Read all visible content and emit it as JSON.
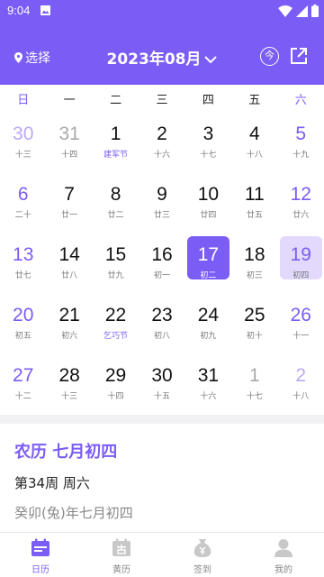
{
  "status_bar": {
    "time": "9:04"
  },
  "header": {
    "location_label": "选择",
    "month_title": "2023年08月",
    "today_button": "今"
  },
  "weekdays": [
    "日",
    "一",
    "二",
    "三",
    "四",
    "五",
    "六"
  ],
  "calendar": [
    [
      {
        "day": "30",
        "lunar": "十三",
        "other": true
      },
      {
        "day": "31",
        "lunar": "十四",
        "other": true
      },
      {
        "day": "1",
        "lunar": "建军节",
        "festival": true
      },
      {
        "day": "2",
        "lunar": "十六"
      },
      {
        "day": "3",
        "lunar": "十七"
      },
      {
        "day": "4",
        "lunar": "十八"
      },
      {
        "day": "5",
        "lunar": "十九"
      }
    ],
    [
      {
        "day": "6",
        "lunar": "二十"
      },
      {
        "day": "7",
        "lunar": "廿一"
      },
      {
        "day": "8",
        "lunar": "廿二"
      },
      {
        "day": "9",
        "lunar": "廿三"
      },
      {
        "day": "10",
        "lunar": "廿四"
      },
      {
        "day": "11",
        "lunar": "廿五"
      },
      {
        "day": "12",
        "lunar": "廿六"
      }
    ],
    [
      {
        "day": "13",
        "lunar": "廿七"
      },
      {
        "day": "14",
        "lunar": "廿八"
      },
      {
        "day": "15",
        "lunar": "廿九"
      },
      {
        "day": "16",
        "lunar": "初一"
      },
      {
        "day": "17",
        "lunar": "初二",
        "selected": true
      },
      {
        "day": "18",
        "lunar": "初三"
      },
      {
        "day": "19",
        "lunar": "初四",
        "today": true
      }
    ],
    [
      {
        "day": "20",
        "lunar": "初五"
      },
      {
        "day": "21",
        "lunar": "初六"
      },
      {
        "day": "22",
        "lunar": "乞巧节",
        "festival": true
      },
      {
        "day": "23",
        "lunar": "初八"
      },
      {
        "day": "24",
        "lunar": "初九"
      },
      {
        "day": "25",
        "lunar": "初十"
      },
      {
        "day": "26",
        "lunar": "十一"
      }
    ],
    [
      {
        "day": "27",
        "lunar": "十二"
      },
      {
        "day": "28",
        "lunar": "十三"
      },
      {
        "day": "29",
        "lunar": "十四"
      },
      {
        "day": "30",
        "lunar": "十五"
      },
      {
        "day": "31",
        "lunar": "十六"
      },
      {
        "day": "1",
        "lunar": "十七",
        "other": true
      },
      {
        "day": "2",
        "lunar": "十八",
        "other": true
      }
    ]
  ],
  "info": {
    "lunar_title": "农历 七月初四",
    "week_line": "第34周 周六",
    "ganzhi": "癸卯(兔)年七月初四"
  },
  "tabs": [
    {
      "label": "日历",
      "icon": "calendar-icon",
      "active": true
    },
    {
      "label": "黄历",
      "icon": "almanac-icon"
    },
    {
      "label": "签到",
      "icon": "money-bag-icon"
    },
    {
      "label": "我的",
      "icon": "user-icon"
    }
  ],
  "colors": {
    "accent": "#7b5cf5",
    "today_bg": "#e2d9fd"
  }
}
